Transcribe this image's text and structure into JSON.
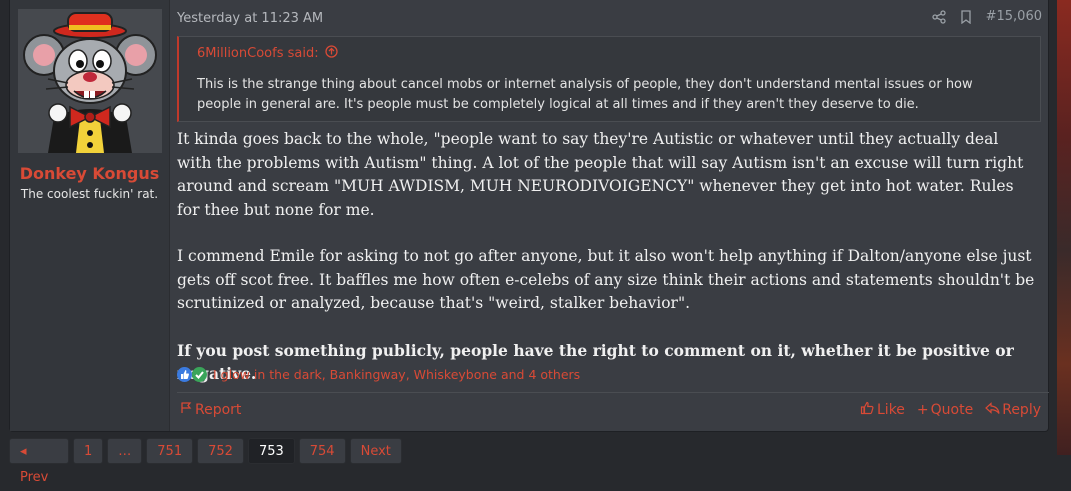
{
  "post": {
    "timestamp": "Yesterday at 11:23 AM",
    "post_number": "#15,060",
    "author": {
      "name": "Donkey Kongus",
      "title": "The coolest fuckin' rat."
    },
    "quote": {
      "author_line": "6MillionCoofs said:",
      "text": "This is the strange thing about cancel mobs or internet analysis of people, they don't understand mental issues or how people in general are. It's people must be completely logical at all times and if they aren't they deserve to die."
    },
    "paragraphs": [
      "It kinda goes back to the whole, \"people want to say they're Autistic or whatever until they actually deal with the problems with Autism\" thing. A lot of the people that will say Autism isn't an excuse will turn right around and scream \"MUH AWDISM, MUH NEURODIVOIGENCY\" whenever they get into hot water. Rules for thee but none for me.",
      "I commend Emile for asking to not go after anyone, but it also won't help anything if Dalton/anyone else just gets off scot free. It baffles me how often e-celebs of any size think their actions and statements shouldn't be scrutinized or analyzed, because that's \"weird, stalker behavior\"."
    ],
    "bold_paragraph": "If you post something publicly, people have the right to comment on it, whether it be positive or negative.",
    "reactions_text": "I glow in the dark, Bankingway, Whiskeybone and 4 others",
    "actions": {
      "report": "Report",
      "like": "Like",
      "quote": "Quote",
      "reply": "Reply"
    }
  },
  "pagination": {
    "prev": "Prev",
    "first": "1",
    "ellipsis": "…",
    "pages": [
      "751",
      "752",
      "753",
      "754"
    ],
    "current": "753",
    "next": "Next"
  },
  "colors": {
    "accent": "#d84a36",
    "background": "#27292d",
    "post_bg": "#3a3d43"
  }
}
